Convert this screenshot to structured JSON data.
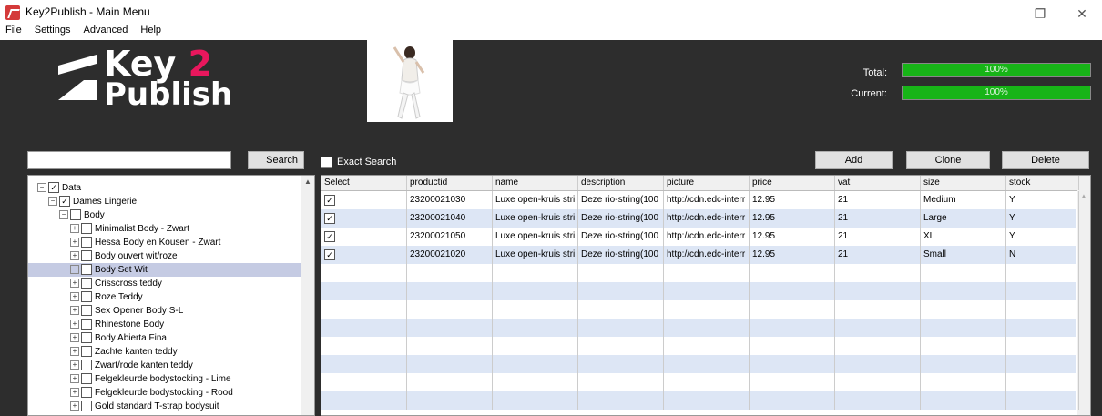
{
  "window": {
    "title": "Key2Publish - Main Menu",
    "minimize": "—",
    "maximize": "❐",
    "close": "✕"
  },
  "menu": [
    "File",
    "Settings",
    "Advanced",
    "Help"
  ],
  "logo": {
    "line1": "Key",
    "digit": "2",
    "line2": "Publish"
  },
  "progress": {
    "total_label": "Total:",
    "total_text": "100%",
    "total_value": 100,
    "current_label": "Current:",
    "current_text": "100%",
    "current_value": 100,
    "color": "#17b417"
  },
  "search": {
    "value": "",
    "button": "Search",
    "exact_label": "Exact Search",
    "exact_checked": false
  },
  "actions": {
    "add": "Add",
    "clone": "Clone",
    "delete": "Delete"
  },
  "tree": [
    {
      "label": "Data",
      "depth": 0,
      "checked": true,
      "expander": "−"
    },
    {
      "label": "Dames Lingerie",
      "depth": 1,
      "checked": true,
      "expander": "−"
    },
    {
      "label": "Body",
      "depth": 2,
      "checked": false,
      "expander": "−"
    },
    {
      "label": "Minimalist Body - Zwart",
      "depth": 3,
      "checked": false,
      "expander": "+"
    },
    {
      "label": "Hessa Body en Kousen - Zwart",
      "depth": 3,
      "checked": false,
      "expander": "+"
    },
    {
      "label": "Body ouvert wit/roze",
      "depth": 3,
      "checked": false,
      "expander": "+"
    },
    {
      "label": "Body Set Wit",
      "depth": 3,
      "checked": false,
      "expander": "−",
      "selected": true
    },
    {
      "label": "Crisscross teddy",
      "depth": 3,
      "checked": false,
      "expander": "+"
    },
    {
      "label": "Roze Teddy",
      "depth": 3,
      "checked": false,
      "expander": "+"
    },
    {
      "label": "Sex Opener Body S-L",
      "depth": 3,
      "checked": false,
      "expander": "+"
    },
    {
      "label": "Rhinestone Body",
      "depth": 3,
      "checked": false,
      "expander": "+"
    },
    {
      "label": "Body Abierta Fina",
      "depth": 3,
      "checked": false,
      "expander": "+"
    },
    {
      "label": "Zachte kanten teddy",
      "depth": 3,
      "checked": false,
      "expander": "+"
    },
    {
      "label": "Zwart/rode kanten teddy",
      "depth": 3,
      "checked": false,
      "expander": "+"
    },
    {
      "label": "Felgekleurde bodystocking - Lime",
      "depth": 3,
      "checked": false,
      "expander": "+"
    },
    {
      "label": "Felgekleurde bodystocking - Rood",
      "depth": 3,
      "checked": false,
      "expander": "+"
    },
    {
      "label": "Gold standard T-strap bodysuit",
      "depth": 3,
      "checked": false,
      "expander": "+"
    }
  ],
  "grid": {
    "columns": [
      "Select",
      "productid",
      "name",
      "description",
      "picture",
      "price",
      "vat",
      "size",
      "stock"
    ],
    "rows": [
      {
        "select": true,
        "productid": "23200021030",
        "name": "Luxe open-kruis stri",
        "description": "Deze rio-string(100",
        "picture": "http://cdn.edc-interr",
        "price": "12.95",
        "vat": "21",
        "size": "Medium",
        "stock": "Y"
      },
      {
        "select": true,
        "productid": "23200021040",
        "name": "Luxe open-kruis stri",
        "description": "Deze rio-string(100",
        "picture": "http://cdn.edc-interr",
        "price": "12.95",
        "vat": "21",
        "size": "Large",
        "stock": "Y"
      },
      {
        "select": true,
        "productid": "23200021050",
        "name": "Luxe open-kruis stri",
        "description": "Deze rio-string(100",
        "picture": "http://cdn.edc-interr",
        "price": "12.95",
        "vat": "21",
        "size": "XL",
        "stock": "Y"
      },
      {
        "select": true,
        "productid": "23200021020",
        "name": "Luxe open-kruis stri",
        "description": "Deze rio-string(100",
        "picture": "http://cdn.edc-interr",
        "price": "12.95",
        "vat": "21",
        "size": "Small",
        "stock": "N"
      }
    ]
  }
}
